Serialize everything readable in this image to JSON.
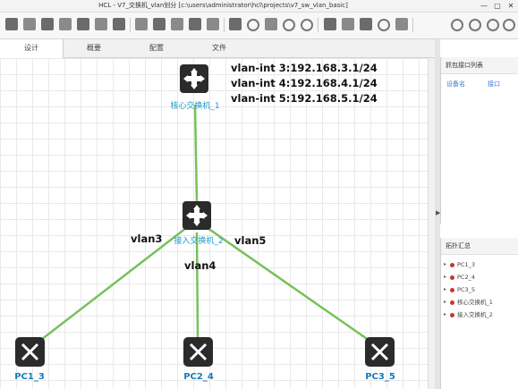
{
  "window": {
    "title": "HCL - V7_交换机_vlan划分 [c:\\users\\administrator\\hcl\\projects\\v7_sw_vlan_basic]",
    "min": "—",
    "max": "▢",
    "close": "✕"
  },
  "tabs": [
    "设计",
    "概要",
    "配置",
    "文件"
  ],
  "topology": {
    "core_label": "核心交换机_1",
    "access_label": "接入交换机_2",
    "pcs": [
      "PC1_3",
      "PC2_4",
      "PC3_5"
    ],
    "vlan_labels": [
      "vlan3",
      "vlan4",
      "vlan5"
    ],
    "vlan_ints": [
      "vlan-int 3:192.168.3.1/24",
      "vlan-int 4:192.168.4.1/24",
      "vlan-int 5:192.168.5.1/24"
    ],
    "link_color": "#77c15a"
  },
  "capture_panel": {
    "title": "抓包接口列表",
    "col_device": "设备名",
    "col_iface": "接口"
  },
  "topo_panel": {
    "title": "拓扑汇总",
    "items": [
      "PC1_3",
      "PC2_4",
      "PC3_5",
      "核心交换机_1",
      "接入交换机_2"
    ]
  }
}
